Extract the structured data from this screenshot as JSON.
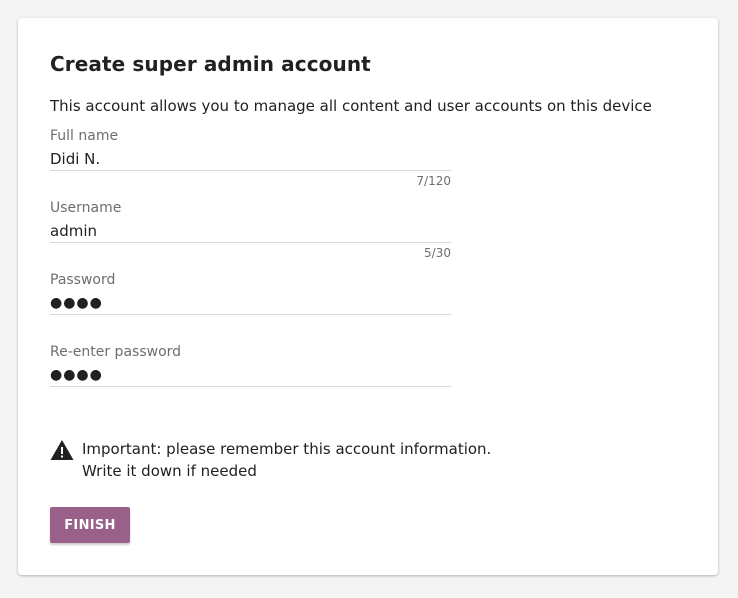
{
  "form": {
    "title": "Create super admin account",
    "description": "This account allows you to manage all content and user accounts on this device",
    "fields": {
      "full_name": {
        "label": "Full name",
        "value": "Didi N.",
        "counter": "7/120"
      },
      "username": {
        "label": "Username",
        "value": "admin",
        "counter": "5/30"
      },
      "password": {
        "label": "Password",
        "value": "●●●●"
      },
      "re_password": {
        "label": "Re-enter password",
        "value": "●●●●"
      }
    },
    "notice": {
      "icon": "warning-icon",
      "line1": "Important: please remember this account information.",
      "line2": "Write it down if needed"
    },
    "finish_label": "FINISH"
  },
  "colors": {
    "accent": "#996189",
    "background": "#f4f4f4",
    "card": "#ffffff",
    "label": "#6e6e6e",
    "divider": "#d8d8d8"
  }
}
